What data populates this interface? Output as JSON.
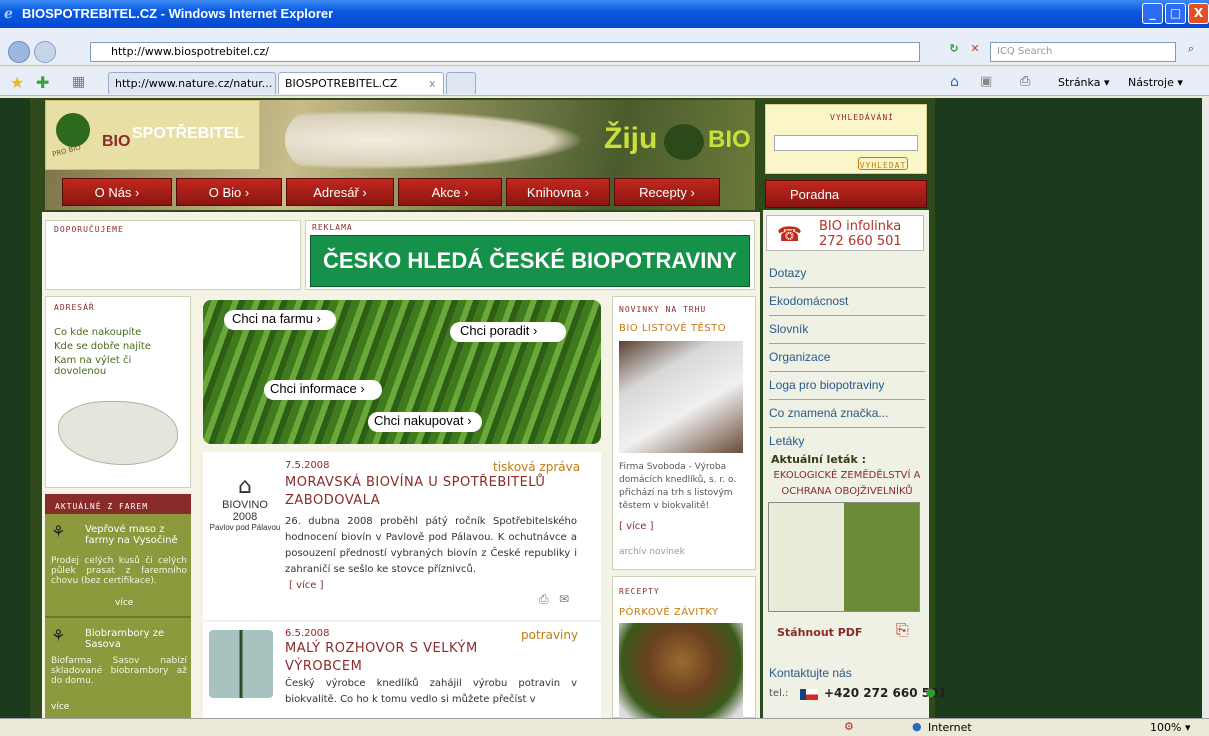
{
  "window": {
    "title": "BIOSPOTREBITEL.CZ - Windows Internet Explorer",
    "min": "_",
    "max": "□",
    "close": "X"
  },
  "address": {
    "url": "http://www.biospotrebitel.cz/",
    "search_placeholder": "ICQ Search"
  },
  "tabs": [
    {
      "label": "http://www.nature.cz/natur..."
    },
    {
      "label": "BIOSPOTREBITEL.CZ"
    },
    {
      "label": "x"
    }
  ],
  "toolbar": {
    "page": "Stránka",
    "tools": "Nástroje"
  },
  "site": {
    "logo_prefix": "BIO",
    "logo_suffix": "SPOTŘEBITEL",
    "logo_small": "PRO BIO",
    "ziju": "Žiju",
    "bio": "BIO",
    "nav": [
      "O Nás",
      "O Bio",
      "Adresář",
      "Akce",
      "Knihovna",
      "Recepty"
    ],
    "search_title": "VYHLEDÁVÁNÍ",
    "search_button": "VYHLEDAT",
    "poradna": "Poradna",
    "infolinka_label": "BIO infolinka",
    "infolinka_number": "272 660 501",
    "doporucujeme": "DOPORUČUJEME",
    "reklama": "REKLAMA",
    "banner": "ČESKO HLEDÁ ČESKÉ BIOPOTRAVINY",
    "adresar": {
      "title": "ADRESÁŘ",
      "links": [
        "Co kde nakoupíte",
        "Kde se dobře najíte",
        "Kam na výlet či dovolenou"
      ]
    },
    "farm": {
      "buttons": [
        "Chci na farmu",
        "Chci poradit",
        "Chci informace",
        "Chci nakupovat"
      ]
    },
    "news1": {
      "date": "7.5.2008",
      "tag": "tisková zpráva",
      "title": "MORAVSKÁ BIOVÍNA U SPOTŘEBITELŮ ZABODOVALA",
      "logo": "BIOVINO 2008",
      "logo_sub": "Pavlov pod Pálavou",
      "text": "26. dubna 2008 proběhl pátý ročník Spotřebitelského hodnocení biovín v Pavlově pod Pálavou. K ochutnávce a posouzení předností vybraných biovín z České republiky i zahraničí se sešlo ke stovce příznivců.",
      "more": "[ více ]"
    },
    "news2": {
      "date": "6.5.2008",
      "tag": "potraviny",
      "title": "MALÝ ROZHOVOR S VELKÝM VÝROBCEM",
      "text": "Český výrobce knedlíků zahájil výrobu potravin v biokvalitě. Co ho k tomu vedlo si můžete přečíst v"
    },
    "farmy": {
      "title": "AKTUÁLNĚ Z FAREM",
      "items": [
        {
          "title": "Vepřové maso z farmy na Vysočině",
          "text": "Prodej celých kusů či celých půlek prasat z faremního chovu (bez certifikace).",
          "more": "více"
        },
        {
          "title": "Biobrambory ze Sasova",
          "text": "Biofarma Sasov nabízí skladované biobrambory až do domu.",
          "more": "více"
        }
      ]
    },
    "novinky": {
      "title": "NOVINKY NA TRHU",
      "item_title": "BIO LISTOVÉ TĚSTO",
      "text": "Firma Svoboda - Výroba domácích knedlíků, s. r. o. přichází na trh s listovým těstem v biokvalitě!",
      "more": "[ více ]",
      "archive": "archív novinek"
    },
    "recepty": {
      "title": "RECEPTY",
      "item_title": "PÓRKOVÉ ZÁVITKY"
    },
    "right_links": [
      "Dotazy",
      "Ekodomácnost",
      "Slovník",
      "Organizace",
      "Loga pro biopotraviny",
      "Co znamená značka...",
      "Letáky"
    ],
    "letak": {
      "label": "Aktuální leták :",
      "title": "EKOLOGICKÉ ZEMĚDĚLSTVÍ A OCHRANA OBOJŽIVELNÍKŮ",
      "pdf": "Stáhnout PDF"
    },
    "kontakt": {
      "label": "Kontaktujte nás",
      "tel_label": "tel.:",
      "tel": "+420 272 660 501"
    }
  },
  "status": {
    "zone": "Internet",
    "zoom": "100%"
  }
}
